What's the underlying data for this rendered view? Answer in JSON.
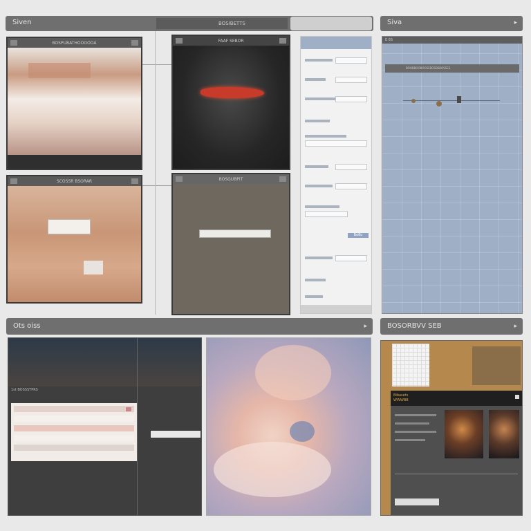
{
  "top_bar": {
    "title": "Siven",
    "button": "▸"
  },
  "right_top_bar": {
    "title": "Siva",
    "button": "▸"
  },
  "bottom_left_bar": {
    "title": "Ots oiss",
    "button": "▸"
  },
  "bottom_right_bar": {
    "title": "BOSORBVV SEB",
    "button": "▸"
  },
  "center_tab": {
    "text": "BOSIBETTS"
  },
  "panel_a": {
    "title": "BOSPUBATHOOOOOA",
    "dot": "■"
  },
  "panel_b": {
    "title": "FAAF SEBOR"
  },
  "panel_c": {
    "title": "SCOSSR BSORAR"
  },
  "panel_d": {
    "title": "BOSGUBPIT"
  },
  "right_panel": {
    "row1": "BOOBBOOBOOSEBOSBSBOSSES",
    "corner": "E 6S"
  },
  "bottom_left_panel": {
    "label": "1st BOSSSTPRS"
  },
  "bottom_right_panel": {
    "header": "Bibasets",
    "header2": "WWWBB"
  },
  "form": {
    "submit": "Bo8o"
  },
  "colors": {
    "chrome": "#6f6f6f",
    "dark": "#2d2d2d",
    "accent": "#c83b2a",
    "blue": "#9fb0c6"
  }
}
